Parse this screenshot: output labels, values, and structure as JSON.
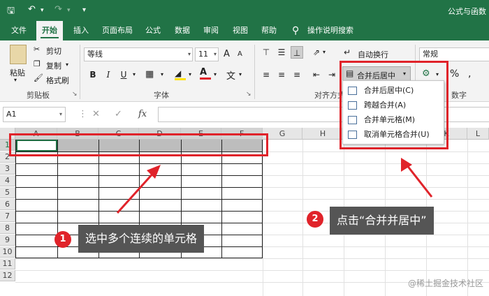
{
  "title_bar": {
    "window_title": "公式与函数"
  },
  "tabs": [
    "文件",
    "开始",
    "插入",
    "页面布局",
    "公式",
    "数据",
    "审阅",
    "视图",
    "帮助",
    "操作说明搜索"
  ],
  "clipboard": {
    "paste": "粘贴",
    "cut": "剪切",
    "copy": "复制",
    "format_painter": "格式刷",
    "group": "剪贴板"
  },
  "font": {
    "name": "等线",
    "size": "11",
    "bold": "B",
    "italic": "I",
    "underline": "U",
    "grow": "A",
    "shrink": "A",
    "group": "字体"
  },
  "alignment": {
    "wrap": "自动换行",
    "merge_center": "合并后居中",
    "group": "对齐方式"
  },
  "number": {
    "format": "常规",
    "percent": "%",
    "group": "数字"
  },
  "merge_menu": {
    "items": [
      "合并后居中(C)",
      "跨越合并(A)",
      "合并单元格(M)",
      "取消单元格合并(U)"
    ]
  },
  "formula_bar": {
    "name_box": "A1",
    "cancel": "✕",
    "enter": "✓",
    "fx": "fx"
  },
  "columns": [
    "A",
    "B",
    "C",
    "D",
    "E",
    "F",
    "G",
    "H",
    "I",
    "J",
    "K",
    "L"
  ],
  "rows": [
    "1",
    "2",
    "3",
    "4",
    "5",
    "6",
    "7",
    "8",
    "9",
    "10",
    "11",
    "12"
  ],
  "callouts": {
    "step1_badge": "1",
    "step1_text": "选中多个连续的单元格",
    "step2_badge": "2",
    "step2_text": "点击“合并并居中”"
  },
  "watermark": "@稀土掘金技术社区",
  "colors": {
    "excel_green": "#217346",
    "highlight_red": "#e0232a"
  }
}
